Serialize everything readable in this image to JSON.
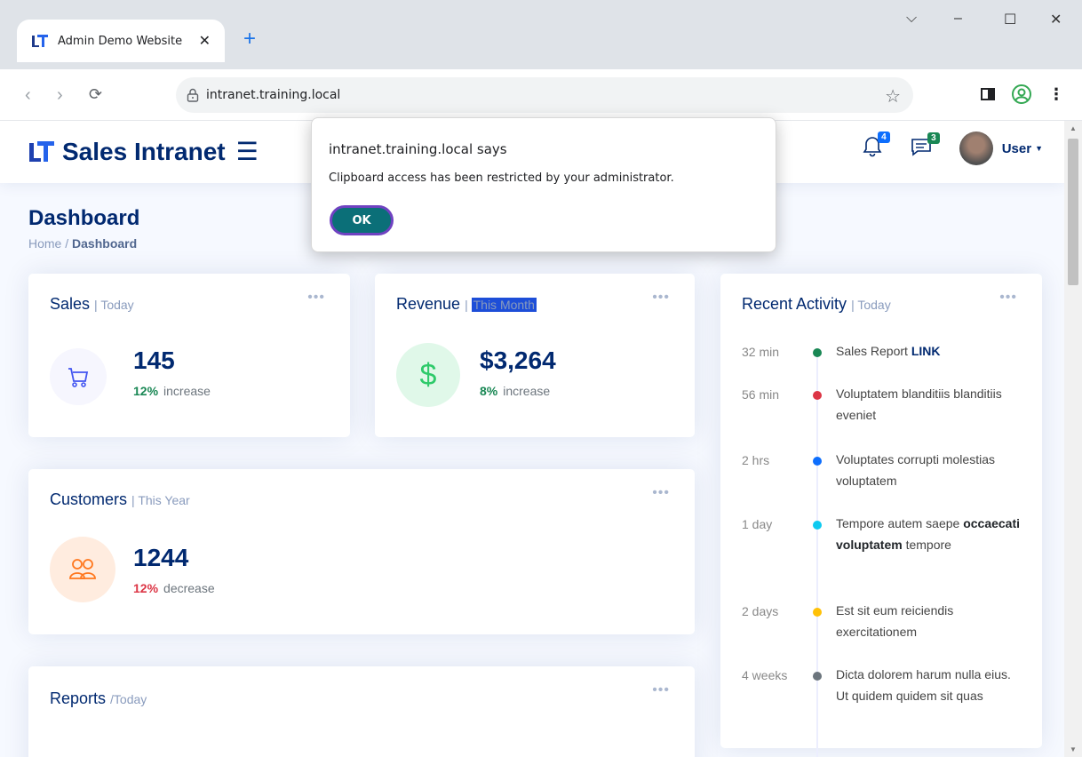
{
  "browser": {
    "tab_title": "Admin Demo Website",
    "tab_close": "✕",
    "new_tab": "+",
    "url": "intranet.training.local",
    "win_min": "–",
    "win_max": "☐",
    "win_close": "✕",
    "win_dropdown": "⌵"
  },
  "header": {
    "brand": "Sales Intranet",
    "notifications_count": "4",
    "messages_count": "3",
    "user": "User"
  },
  "page": {
    "title": "Dashboard",
    "breadcrumb_home": "Home",
    "breadcrumb_sep": " / ",
    "breadcrumb_current": "Dashboard"
  },
  "cards": {
    "sales": {
      "title": "Sales",
      "period": "| Today",
      "value": "145",
      "pct": "12%",
      "trend": "increase"
    },
    "revenue": {
      "title": "Revenue",
      "sep": "| ",
      "period": "This Month",
      "value": "$3,264",
      "pct": "8%",
      "trend": "increase"
    },
    "customers": {
      "title": "Customers",
      "period": "| This Year",
      "value": "1244",
      "pct": "12%",
      "trend": "decrease"
    },
    "reports": {
      "title": "Reports",
      "period": "/Today"
    },
    "activity": {
      "title": "Recent Activity",
      "period": "| Today",
      "items": [
        {
          "time": "32 min",
          "text": "Sales Report ",
          "bold": "LINK",
          "text2": ""
        },
        {
          "time": "56 min",
          "text": "Voluptatem blanditiis blanditiis eveniet",
          "bold": "",
          "text2": ""
        },
        {
          "time": "2 hrs",
          "text": "Voluptates corrupti molestias voluptatem",
          "bold": "",
          "text2": ""
        },
        {
          "time": "1 day",
          "text": "Tempore autem saepe ",
          "bold": "occaecati voluptatem",
          "text2": " tempore"
        },
        {
          "time": "2 days",
          "text": "Est sit eum reiciendis exercitationem",
          "bold": "",
          "text2": ""
        },
        {
          "time": "4 weeks",
          "text": "Dicta dolorem harum nulla eius. Ut quidem quidem sit quas",
          "bold": "",
          "text2": ""
        }
      ]
    }
  },
  "dialog": {
    "title": "intranet.training.local says",
    "message": "Clipboard access has been restricted by your administrator.",
    "ok": "OK"
  },
  "colors": {
    "brand": "#012970",
    "green": "#198754",
    "red": "#dc3545",
    "blue": "#0d6efd",
    "cyan": "#0dcaf0",
    "yellow": "#ffc107",
    "gray": "#6c757d"
  }
}
